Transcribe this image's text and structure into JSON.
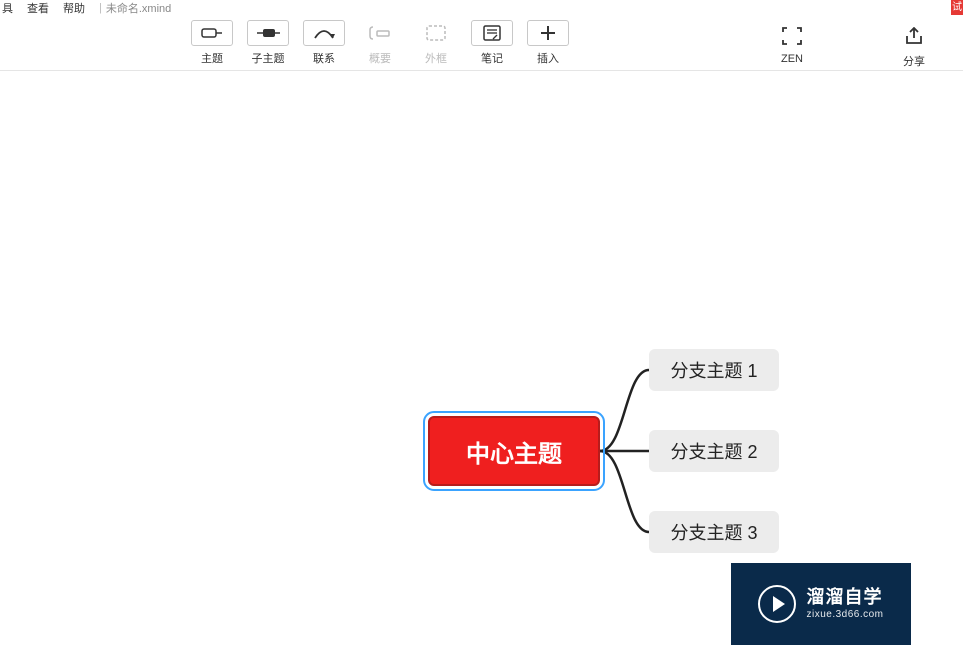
{
  "menu": {
    "item0_fragment": "具",
    "view": "查看",
    "help": "帮助",
    "filename": "未命名.xmind",
    "red_tab": "试"
  },
  "toolbar": {
    "topic": "主题",
    "subtopic": "子主题",
    "relationship": "联系",
    "summary": "概要",
    "boundary": "外框",
    "notes": "笔记",
    "insert": "插入",
    "zen": "ZEN",
    "share": "分享"
  },
  "mindmap": {
    "central": "中心主题",
    "branches": [
      "分支主题 1",
      "分支主题 2",
      "分支主题 3"
    ]
  },
  "watermark": {
    "title": "溜溜自学",
    "url": "zixue.3d66.com"
  }
}
